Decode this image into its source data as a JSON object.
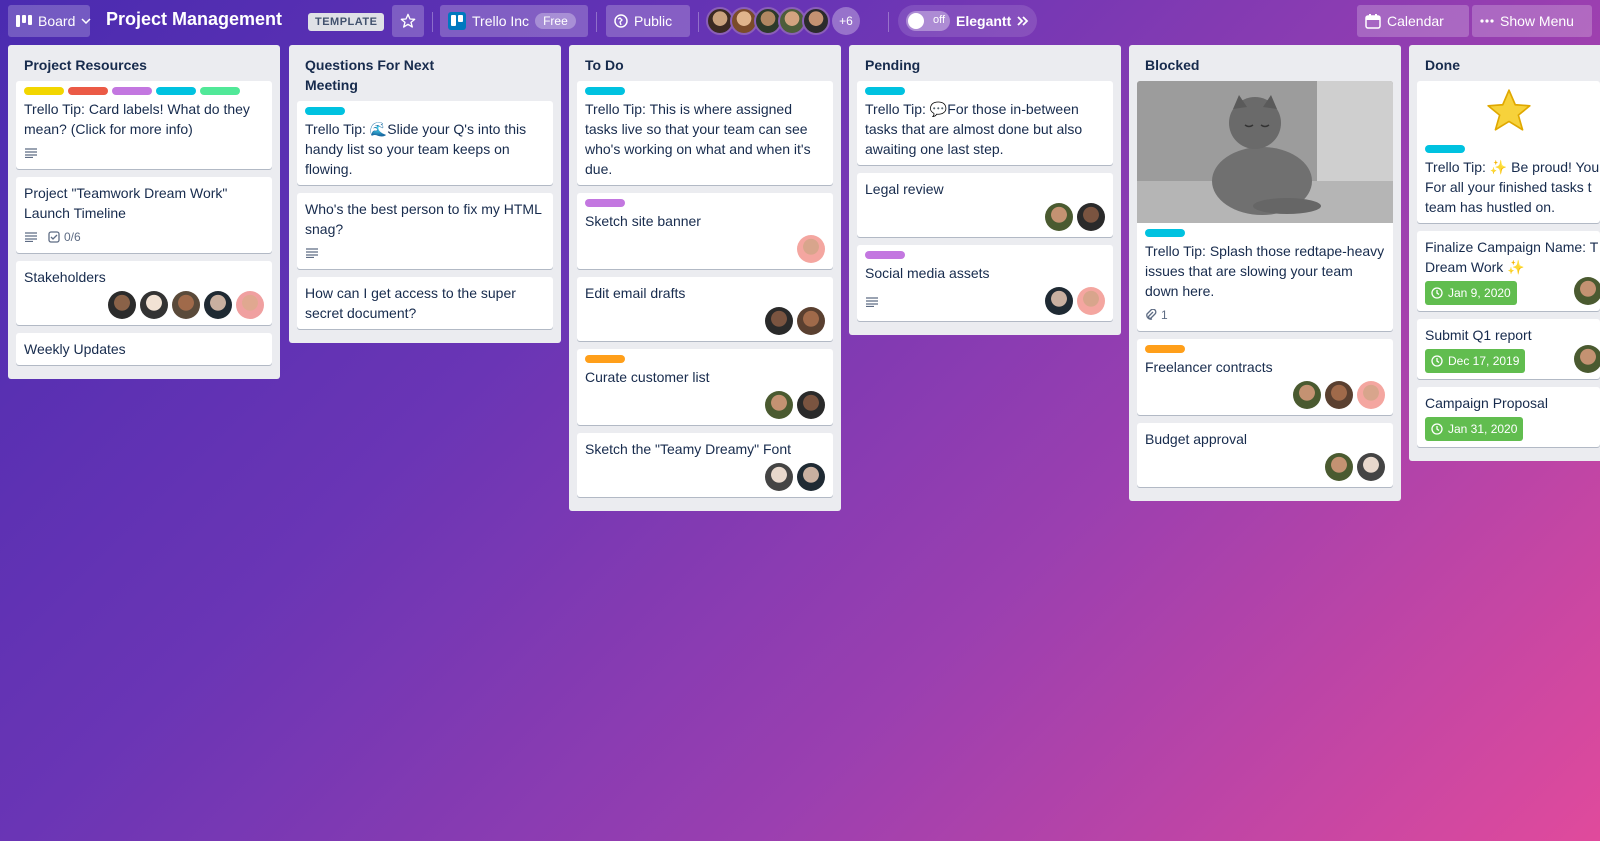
{
  "header": {
    "board_button": "Board",
    "title": "Project Management",
    "template_badge": "TEMPLATE",
    "workspace": "Trello Inc",
    "workspace_plan": "Free",
    "visibility": "Public",
    "member_overflow": "+6",
    "elegantt_toggle": "off",
    "elegantt_label": "Elegantt",
    "calendar_button": "Calendar",
    "menu_button": "Show Menu"
  },
  "colors": {
    "label_yellow": "#f2d600",
    "label_red": "#eb5a46",
    "label_purple": "#c377e0",
    "label_sky": "#00c2e0",
    "label_lime": "#51e898",
    "label_orange": "#ff9f1a",
    "due_green": "#61bd4f"
  },
  "lists": [
    {
      "title": "Project Resources",
      "cards": [
        {
          "title": "Trello Tip: Card labels! What do they mean? (Click for more info)",
          "labels": [
            "yellow",
            "red",
            "purple",
            "sky",
            "lime"
          ],
          "has_description": true
        },
        {
          "title": "Project \"Teamwork Dream Work\" Launch Timeline",
          "has_description": true,
          "checklist": "0/6"
        },
        {
          "title": "Stakeholders",
          "members": 5
        },
        {
          "title": "Weekly Updates"
        }
      ]
    },
    {
      "title": "Questions For Next Meeting",
      "cards": [
        {
          "title": "Trello Tip: 🌊Slide your Q's into this handy list so your team keeps on flowing.",
          "labels": [
            "sky"
          ]
        },
        {
          "title": "Who's the best person to fix my HTML snag?",
          "has_description": true
        },
        {
          "title": "How can I get access to the super secret document?"
        }
      ]
    },
    {
      "title": "To Do",
      "cards": [
        {
          "title": "Trello Tip: This is where assigned tasks live so that your team can see who's working on what and when it's due.",
          "labels": [
            "sky"
          ]
        },
        {
          "title": "Sketch site banner",
          "labels": [
            "purple"
          ],
          "members": 1
        },
        {
          "title": "Edit email drafts",
          "members": 2
        },
        {
          "title": "Curate customer list",
          "labels": [
            "orange"
          ],
          "members": 2
        },
        {
          "title": "Sketch the \"Teamy Dreamy\" Font",
          "members": 2
        }
      ]
    },
    {
      "title": "Pending",
      "cards": [
        {
          "title": "Trello Tip: 💬For those in-between tasks that are almost done but also awaiting one last step.",
          "labels": [
            "sky"
          ]
        },
        {
          "title": "Legal review",
          "members": 2
        },
        {
          "title": "Social media assets",
          "labels": [
            "purple"
          ],
          "has_description": true,
          "members": 2
        }
      ]
    },
    {
      "title": "Blocked",
      "cards": [
        {
          "title": "Trello Tip: Splash those redtape-heavy issues that are slowing your team down here.",
          "cover": "sleepy-cat-photo",
          "labels": [
            "sky"
          ],
          "attachments": "1"
        },
        {
          "title": "Freelancer contracts",
          "labels": [
            "orange"
          ],
          "members": 3
        },
        {
          "title": "Budget approval",
          "members": 2
        }
      ]
    },
    {
      "title": "Done",
      "cards": [
        {
          "title": "Trello Tip: ✨ Be proud! You For all your finished tasks t team has hustled on.",
          "cover": "star",
          "labels": [
            "sky"
          ]
        },
        {
          "title": "Finalize Campaign Name: T Dream Work ✨",
          "due": "Jan 9, 2020",
          "members": 1
        },
        {
          "title": "Submit Q1 report",
          "due": "Dec 17, 2019",
          "members": 1
        },
        {
          "title": "Campaign Proposal",
          "due": "Jan 31, 2020"
        }
      ]
    }
  ]
}
